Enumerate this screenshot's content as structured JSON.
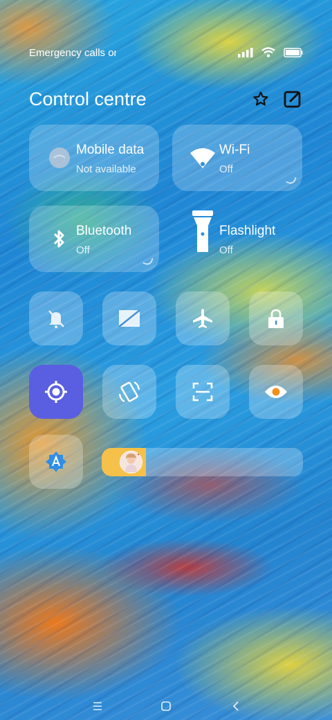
{
  "status": {
    "carrier": "Emergency calls only",
    "signal_icon": "signal-bars-icon",
    "wifi_icon": "wifi-icon",
    "battery_icon": "battery-icon"
  },
  "header": {
    "title": "Control centre",
    "favorite_icon": "star-icon",
    "edit_icon": "edit-icon"
  },
  "tiles_big": [
    {
      "name": "Mobile data",
      "state": "Not available",
      "icon": "mobile-data-icon"
    },
    {
      "name": "Wi-Fi",
      "state": "Off",
      "icon": "wifi-icon"
    },
    {
      "name": "Bluetooth",
      "state": "Off",
      "icon": "bluetooth-icon"
    },
    {
      "name": "Flashlight",
      "state": "Off",
      "icon": "flashlight-icon"
    }
  ],
  "tiles_small": [
    {
      "icon": "mute-bell-icon",
      "active": false
    },
    {
      "icon": "screen-rotation-icon",
      "active": false
    },
    {
      "icon": "airplane-icon",
      "active": false
    },
    {
      "icon": "lock-icon",
      "active": false
    },
    {
      "icon": "location-icon",
      "active": true
    },
    {
      "icon": "auto-rotate-icon",
      "active": false
    },
    {
      "icon": "screenshot-icon",
      "active": false
    },
    {
      "icon": "eye-reading-mode-icon",
      "active": false
    },
    {
      "icon": "auto-brightness-icon",
      "active": false
    }
  ],
  "brightness": {
    "level": 0.22
  },
  "colors": {
    "active_tile": "#5a5ee0",
    "slider_fill": "#f5c14a"
  },
  "navbar": {
    "menu_icon": "menu-icon",
    "home_icon": "home-icon",
    "back_icon": "back-icon"
  }
}
